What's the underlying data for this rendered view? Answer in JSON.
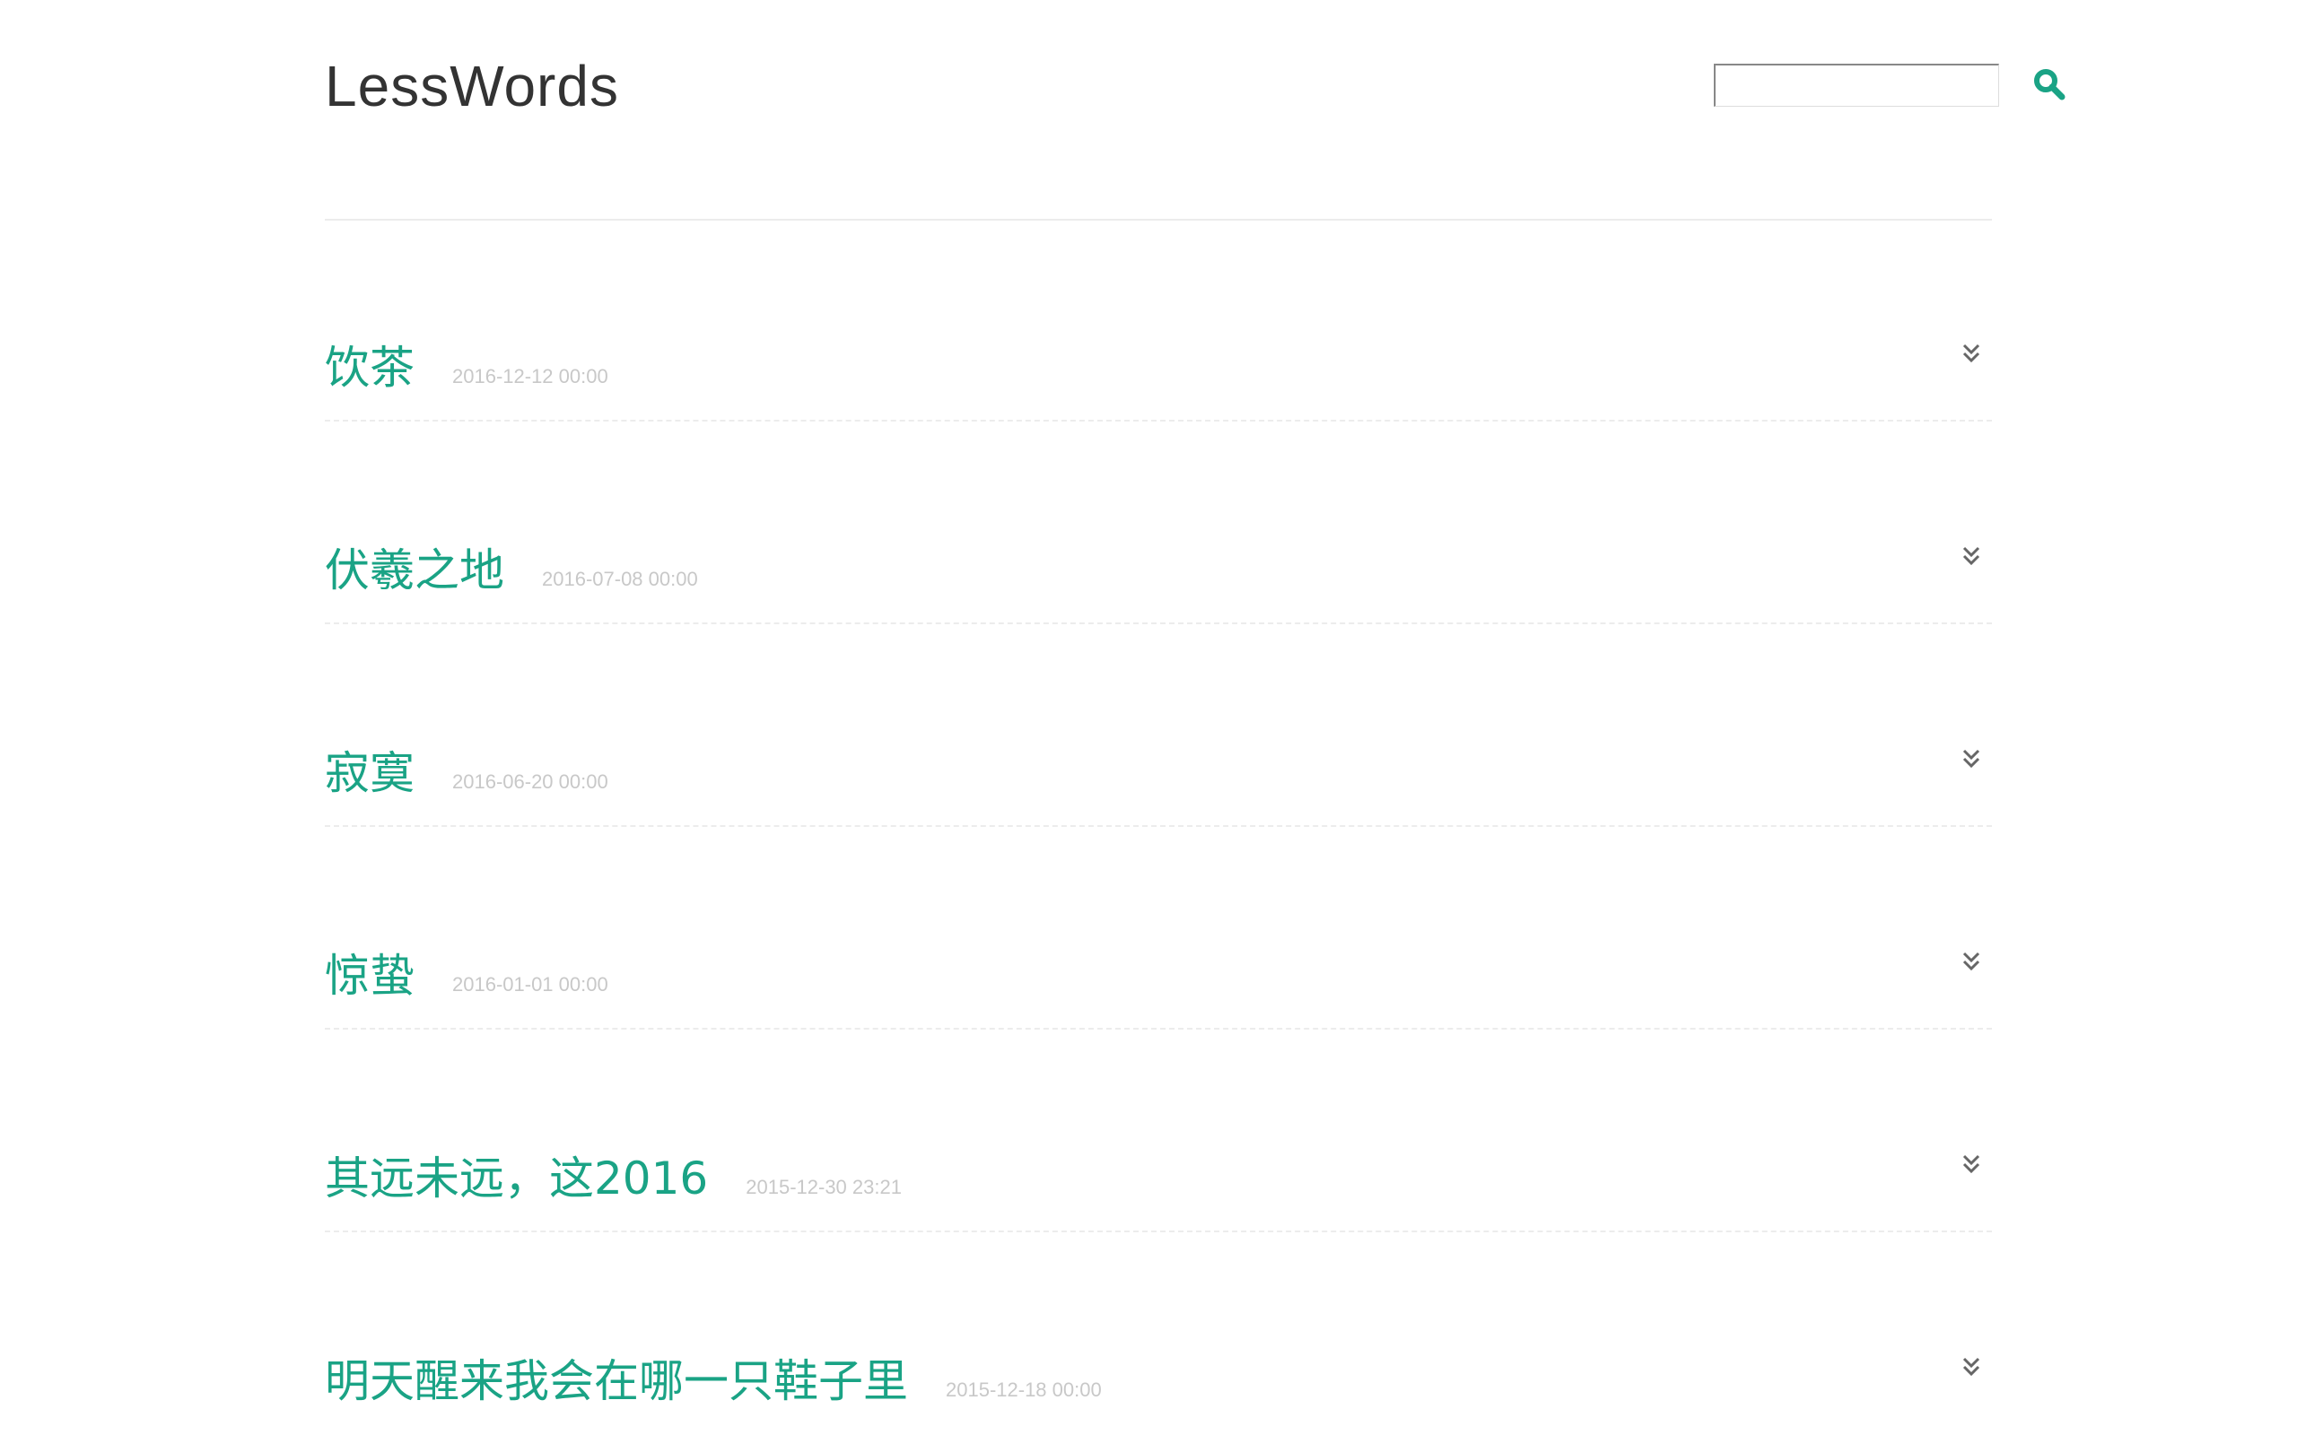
{
  "site": {
    "title": "LessWords",
    "accent": "#1aa385"
  },
  "search": {
    "value": "",
    "placeholder": "",
    "icon": "search-icon"
  },
  "posts": [
    {
      "title": "饮茶",
      "date": "2016-12-12 00:00",
      "icon": "double-chevron-down-icon"
    },
    {
      "title": "伏羲之地",
      "date": "2016-07-08 00:00",
      "icon": "double-chevron-down-icon"
    },
    {
      "title": "寂寞",
      "date": "2016-06-20 00:00",
      "icon": "double-chevron-down-icon"
    },
    {
      "title": "惊蛰",
      "date": "2016-01-01 00:00",
      "icon": "double-chevron-down-icon"
    },
    {
      "title": "其远未远，这2016",
      "date": "2015-12-30 23:21",
      "icon": "double-chevron-down-icon"
    },
    {
      "title": "明天醒来我会在哪一只鞋子里",
      "date": "2015-12-18 00:00",
      "icon": "double-chevron-down-icon"
    }
  ]
}
